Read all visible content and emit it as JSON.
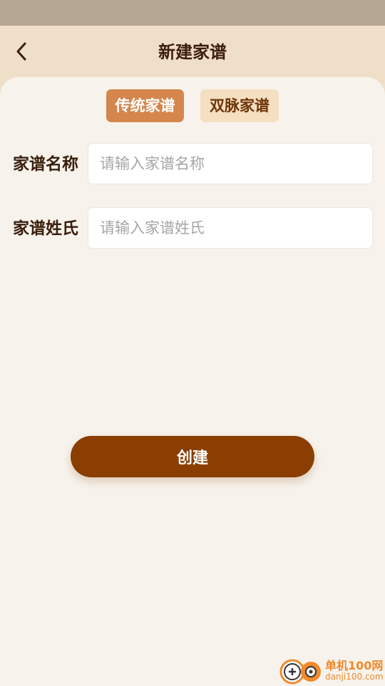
{
  "header": {
    "title": "新建家谱",
    "back_icon": "chevron-left-icon"
  },
  "tabs": [
    {
      "label": "传统家谱",
      "active": true
    },
    {
      "label": "双脉家谱",
      "active": false
    }
  ],
  "form": {
    "name": {
      "label": "家谱名称",
      "value": "",
      "placeholder": "请输入家谱名称"
    },
    "surname": {
      "label": "家谱姓氏",
      "value": "",
      "placeholder": "请输入家谱姓氏"
    }
  },
  "actions": {
    "create_label": "创建"
  },
  "watermark": {
    "name": "单机100网",
    "url": "danji100.com"
  },
  "colors": {
    "status_bar": "#b6a795",
    "header_bg": "#f0dfc8",
    "page_bg": "#f7f3ec",
    "tab_active_bg": "#d4864c",
    "tab_inactive_bg": "#f4dfc1",
    "primary_button": "#8a3e02",
    "title_text": "#3a1e0c"
  }
}
